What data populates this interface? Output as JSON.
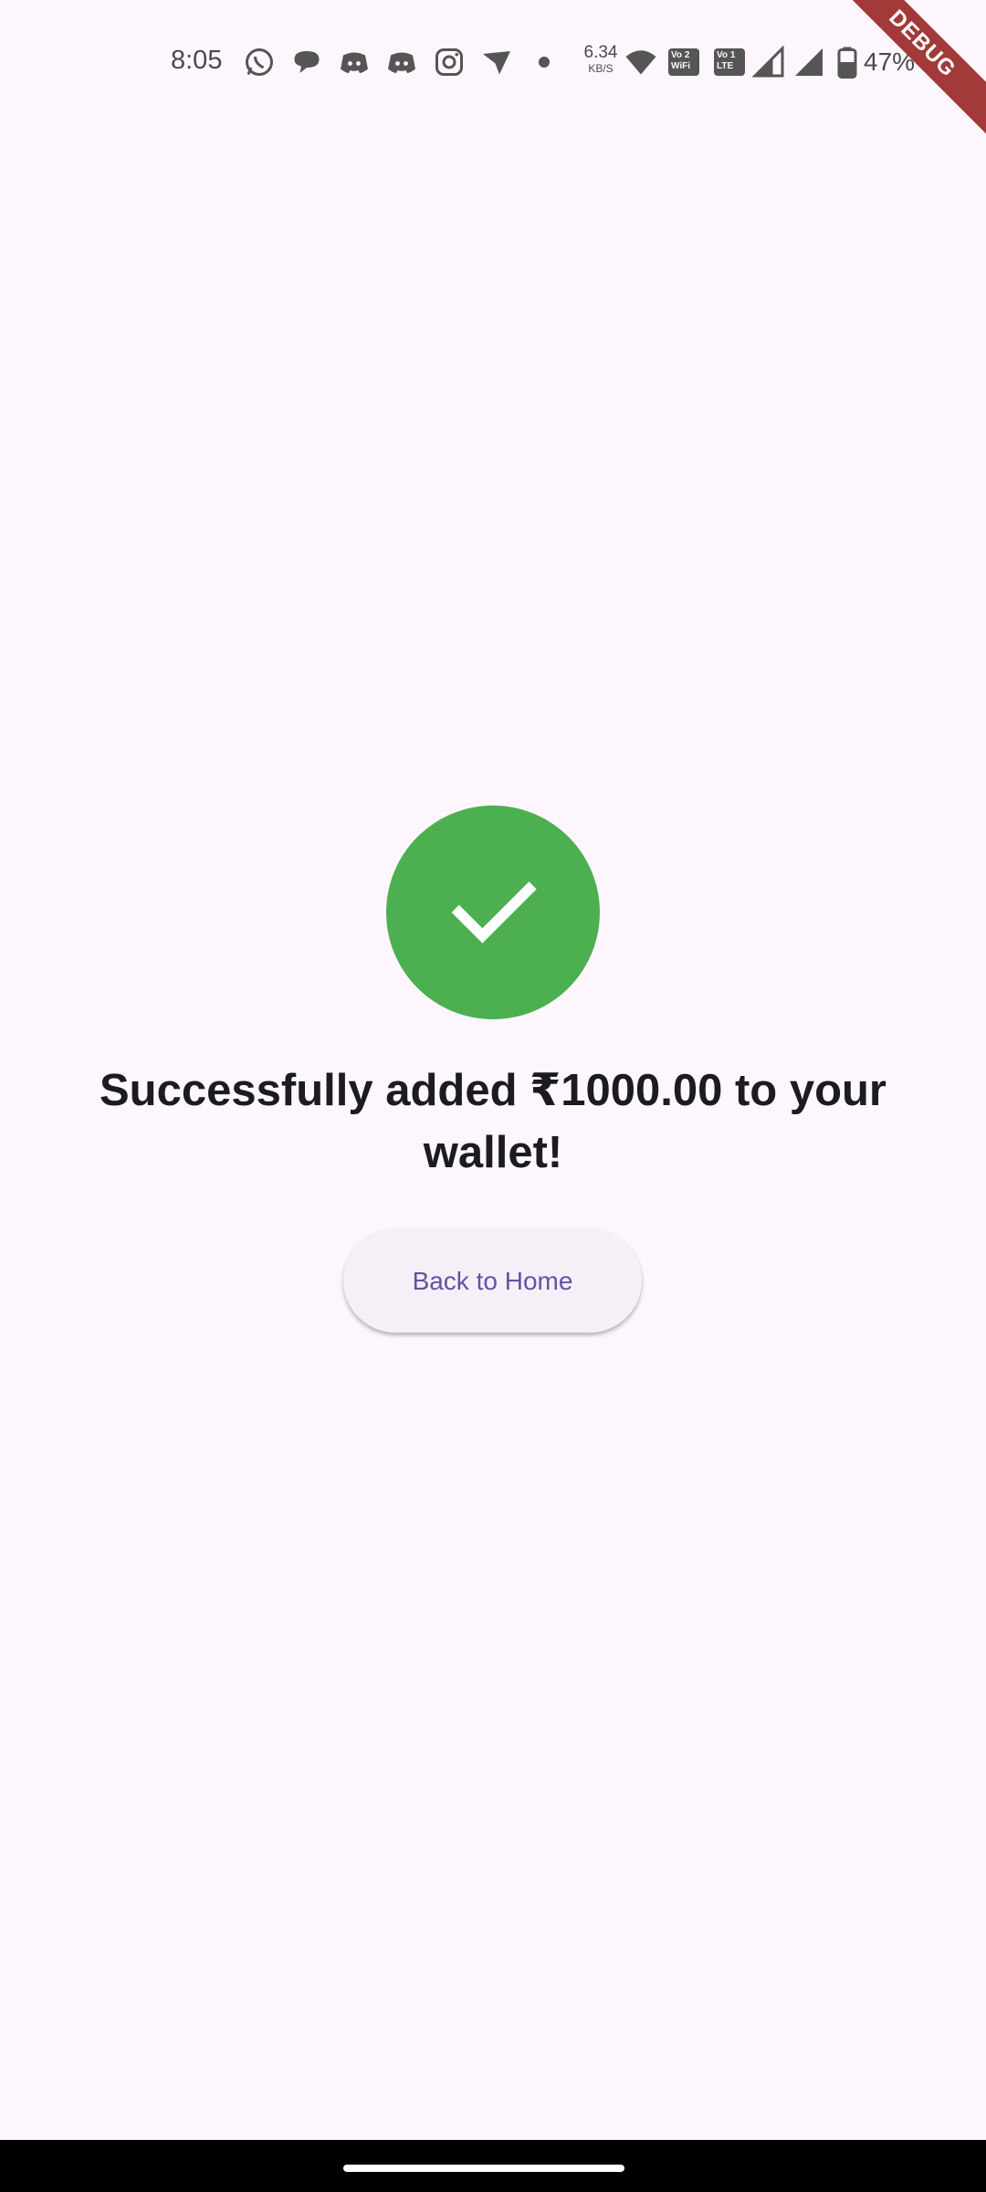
{
  "status_bar": {
    "time": "8:05",
    "network_speed_value": "6.34",
    "network_speed_unit": "KB/S",
    "sim1_badge_top": "Vo 2",
    "sim1_badge_bottom": "WiFi",
    "sim2_badge_top": "Vo 1",
    "sim2_badge_bottom": "LTE",
    "battery_percent": "47%",
    "icons": [
      "whatsapp-icon",
      "chat-bubble-icon",
      "discord-icon",
      "discord-icon",
      "instagram-icon",
      "send-icon",
      "dot-icon",
      "wifi-icon",
      "signal-icon",
      "signal-icon",
      "battery-icon"
    ]
  },
  "debug_banner": {
    "label": "DEBUG",
    "color": "#a23a3a"
  },
  "main": {
    "success_icon": "check-circle-icon",
    "success_color": "#4caf50",
    "message": "Successfully added ₹1000.00 to your wallet!",
    "button_label": "Back to Home",
    "button_text_color": "#6750a4"
  }
}
